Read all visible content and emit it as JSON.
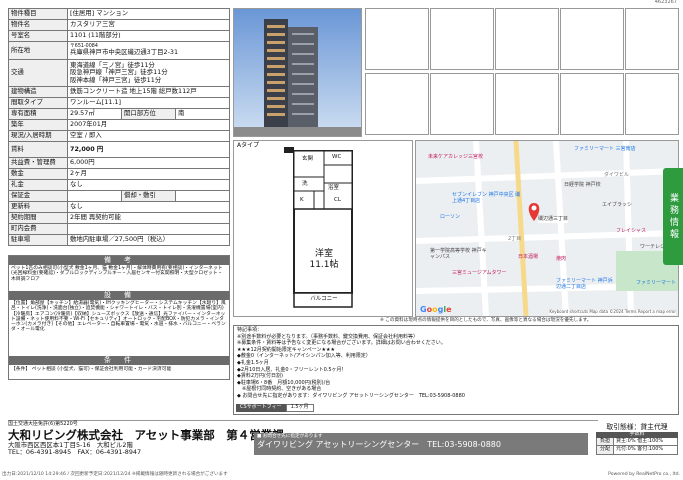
{
  "header_code": "4623267",
  "spec": {
    "rows": [
      {
        "k": "物件種目",
        "v": "[住居用] マンション"
      },
      {
        "k": "物件名",
        "v": "カスタリア三宮"
      },
      {
        "k": "号室名",
        "v": "1101 (11階部分)"
      },
      {
        "k": "所在地",
        "zip": "〒651-0084",
        "v": "兵庫県神戸市中央区磯辺通3丁目2-31"
      },
      {
        "k": "交通",
        "lines": [
          "東海道線「三ノ宮」徒歩11分",
          "阪急神戸線「神戸三宮」徒歩11分",
          "阪神本線「神戸三宮」徒歩11分"
        ]
      },
      {
        "k": "建物構造",
        "v": "鉄筋コンクリート造 地上15階 総戸数112戸"
      },
      {
        "k": "間取タイプ",
        "v": "ワンルーム[11.1]"
      },
      {
        "k": "専有面積",
        "v": "29.57㎡",
        "k2": "開口部方位",
        "v2": "南"
      },
      {
        "k": "築年",
        "v": "2007年01月"
      },
      {
        "k": "現況/入居時期",
        "v": "空室 / 即入"
      },
      {
        "k": "賃料",
        "v": "72,000 円"
      },
      {
        "k": "共益費・管理費",
        "v": "6,000円"
      },
      {
        "k": "敷金",
        "v": "2ヶ月"
      },
      {
        "k": "礼金",
        "v": "なし"
      },
      {
        "k": "保証金",
        "v": "",
        "k2": "償却・敷引",
        "v2": ""
      },
      {
        "k": "更新料",
        "v": "なし"
      },
      {
        "k": "契約期間",
        "v": "2年間 再契約可能"
      },
      {
        "k": "町内会費",
        "v": ""
      },
      {
        "k": "駐車場",
        "v": "敷地内駐車場／27,500円（税込）"
      }
    ],
    "remarks_title": "備　考",
    "remarks": "ペット1匹のみ相談可(小型犬 敷金1ヶ月、猫 敷金1ヶ月)・解体時費用有(要相談)・インターネット(光回線料金(要確認)・ダブルロックディンプルキー・入居センサー付玄関照明・大型クロゼット・木目調フロア",
    "equip_title": "設　備",
    "equip": "【位置】角部屋【キッチン】給湯器(電気)・IHクッキングヒーター・システムキッチン【水廻り】風呂・トイレ(洗浄)・洗面台(独立)・追焚機能・シャワートイレ・バス・トイレ別・洗濯機置場(室内)【冷暖房】エアコン(冷暖房)【収納】シューズボックス【放送・通信】光ファイバー・インターネット設備・ネット使用料不要・Wi-Fi【セキュリティ】オートロック・宅配BOX・防犯カメラ・インターホン(カメラ付き)【その他】エレベーター・自転車置場・電気・水道・排水・バルコニー・ベランダ・オール電化",
    "terms_title": "条　件",
    "terms": "【条件】 ペット相談 (小型犬、猫可)・保証会社利用可能・カード決済可能"
  },
  "floorplan": {
    "label": "Aタイプ",
    "rooms": {
      "genkan": "玄関",
      "wc": "WC",
      "washer": "洗",
      "yokushitsu": "浴室",
      "kitchen": "K",
      "cl": "CL",
      "yoshitsu": "洋室",
      "size": "11.1帖",
      "balcony": "バルコニー"
    }
  },
  "map": {
    "labels": [
      "未来ケアカレッジ三宮校",
      "ファミリーマート 三宮南店",
      "日経学院 神戸校",
      "セブンイレブン 神戸中央区 磯上通4丁目店",
      "ローソン",
      "磯辺通三丁目",
      "エイブラッシ",
      "第一学院高等学校 神戸キャンパス",
      "三宮ミュージアムタワー",
      "日本酒場",
      "焼肉",
      "フレイシャス",
      "ワーテレジ",
      "ファミリーマート 神戸浜辺通二丁目店",
      "ファミリーマート",
      "2丁目",
      "ダイワビル"
    ],
    "footer": "Keyboard shortcuts   Map data ©2024   Terms   Report a map error"
  },
  "disclaimer": "※ この資料は現時点の情報提供を目的としたもので、写真、画像等と異なる場合は現況を優先します。",
  "notes": {
    "lines": [
      "特記事項：",
      "※別途手数料が必要となります。（事務手数料、鍵交換費用、保証会社利用料等）",
      "※募集条件・賃料等は予告なく変更になる場合がございます。詳細はお問い合わせください。",
      "★★★12月契約開始限定キャンペーン★★★",
      "◆敷金0（インターネット/アイシンパン加入等、利用限定）",
      "◆礼金1.5ヶ月",
      "◆2月10日入居、礼金0・フリーレント0.5ヶ月！",
      "◆賃料2万円(付日割)",
      "◆駐車場6・8番　月額10,000円(税別)/台",
      "　※屋根付同時契約、空きがある場合",
      "◆ お問合せ先に指定があります：ダイワリビング アセットリーシングセンター　TEL:03-5908-0880"
    ],
    "cs_label": "CSサポートフィー",
    "cs_value": "1.5ヶ月"
  },
  "company": {
    "license": "国土交通大臣免許(6)第5220号",
    "name": "大和リビング株式会社　アセット事業部　第４営業課",
    "address": "大阪市西区西区本1丁目5-16　大和ビル2階",
    "tel": "TEL：06-4391-8945　FAX：06-4391-8947",
    "contact_note": "■ お問合せ先に指定があります",
    "contact": "ダイワリビング アセットリーシングセンター　TEL:03-5908-0880"
  },
  "fee": {
    "title": "取引態様：貸主代理",
    "subtitle": "手数料",
    "rows": [
      {
        "k": "負担",
        "v": "貸主:0% 借主:100%"
      },
      {
        "k": "分配",
        "v": "元付:0% 客付:100%"
      }
    ]
  },
  "footer": {
    "left": "出力日:2021/12/10 14:29:46 / 次回更新予定日:2021/12/24 ※掲載情報は随時更新される場合がございます",
    "right": "Powered by RealNetPro co., ltd."
  },
  "side_tab": "業務情報"
}
